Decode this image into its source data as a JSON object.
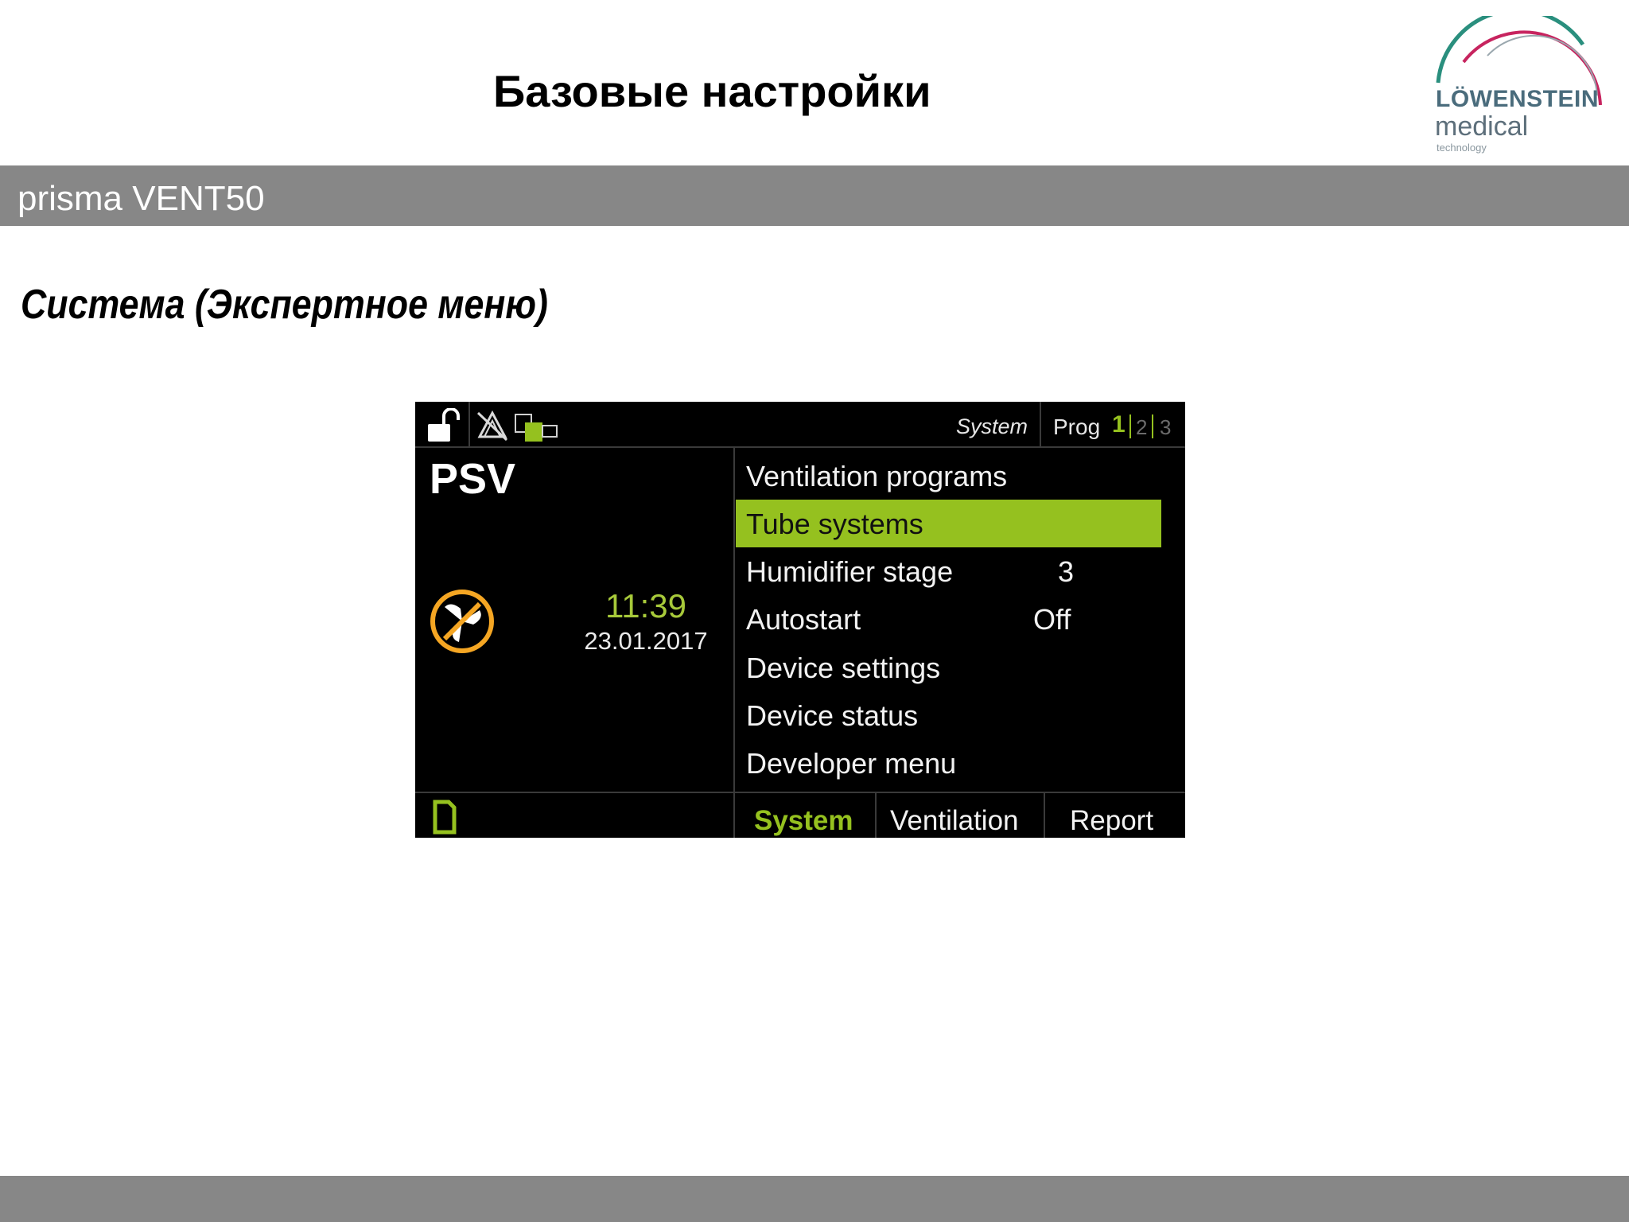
{
  "slide": {
    "title": "Базовые настройки",
    "band_text": "prisma VENT50",
    "subtitle": "Система (Экспертное меню)"
  },
  "logo": {
    "word1": "LÖWENSTEIN",
    "word2": "medical",
    "word3": "technology",
    "arc_colors": [
      "#2a8f7e",
      "#c7245f"
    ]
  },
  "device": {
    "status_icons": [
      "unlock-icon",
      "alarm-silenced-icon",
      "connection-icon"
    ],
    "top_label": "System",
    "prog": {
      "label": "Prog",
      "numbers": [
        "1",
        "2",
        "3"
      ],
      "active": "1"
    },
    "mode": "PSV",
    "standby_icon": "fan-off-icon",
    "time": "11:39",
    "date": "23.01.2017",
    "menu": [
      {
        "label": "Ventilation programs",
        "value": ""
      },
      {
        "label": "Tube systems",
        "value": "",
        "selected": true
      },
      {
        "label": "Humidifier stage",
        "value": "3"
      },
      {
        "label": "Autostart",
        "value": "Off"
      },
      {
        "label": "Device settings",
        "value": ""
      },
      {
        "label": "Device status",
        "value": ""
      },
      {
        "label": "Developer menu",
        "value": ""
      }
    ],
    "sd_icon": "sd-card-icon",
    "tabs": [
      {
        "label": "System",
        "active": true
      },
      {
        "label": "Ventilation",
        "active": false
      },
      {
        "label": "Report",
        "active": false
      }
    ],
    "colors": {
      "accent": "#95c11f",
      "time": "#a7c93a",
      "standby_icon": "#f5a623",
      "background": "#000000"
    }
  }
}
